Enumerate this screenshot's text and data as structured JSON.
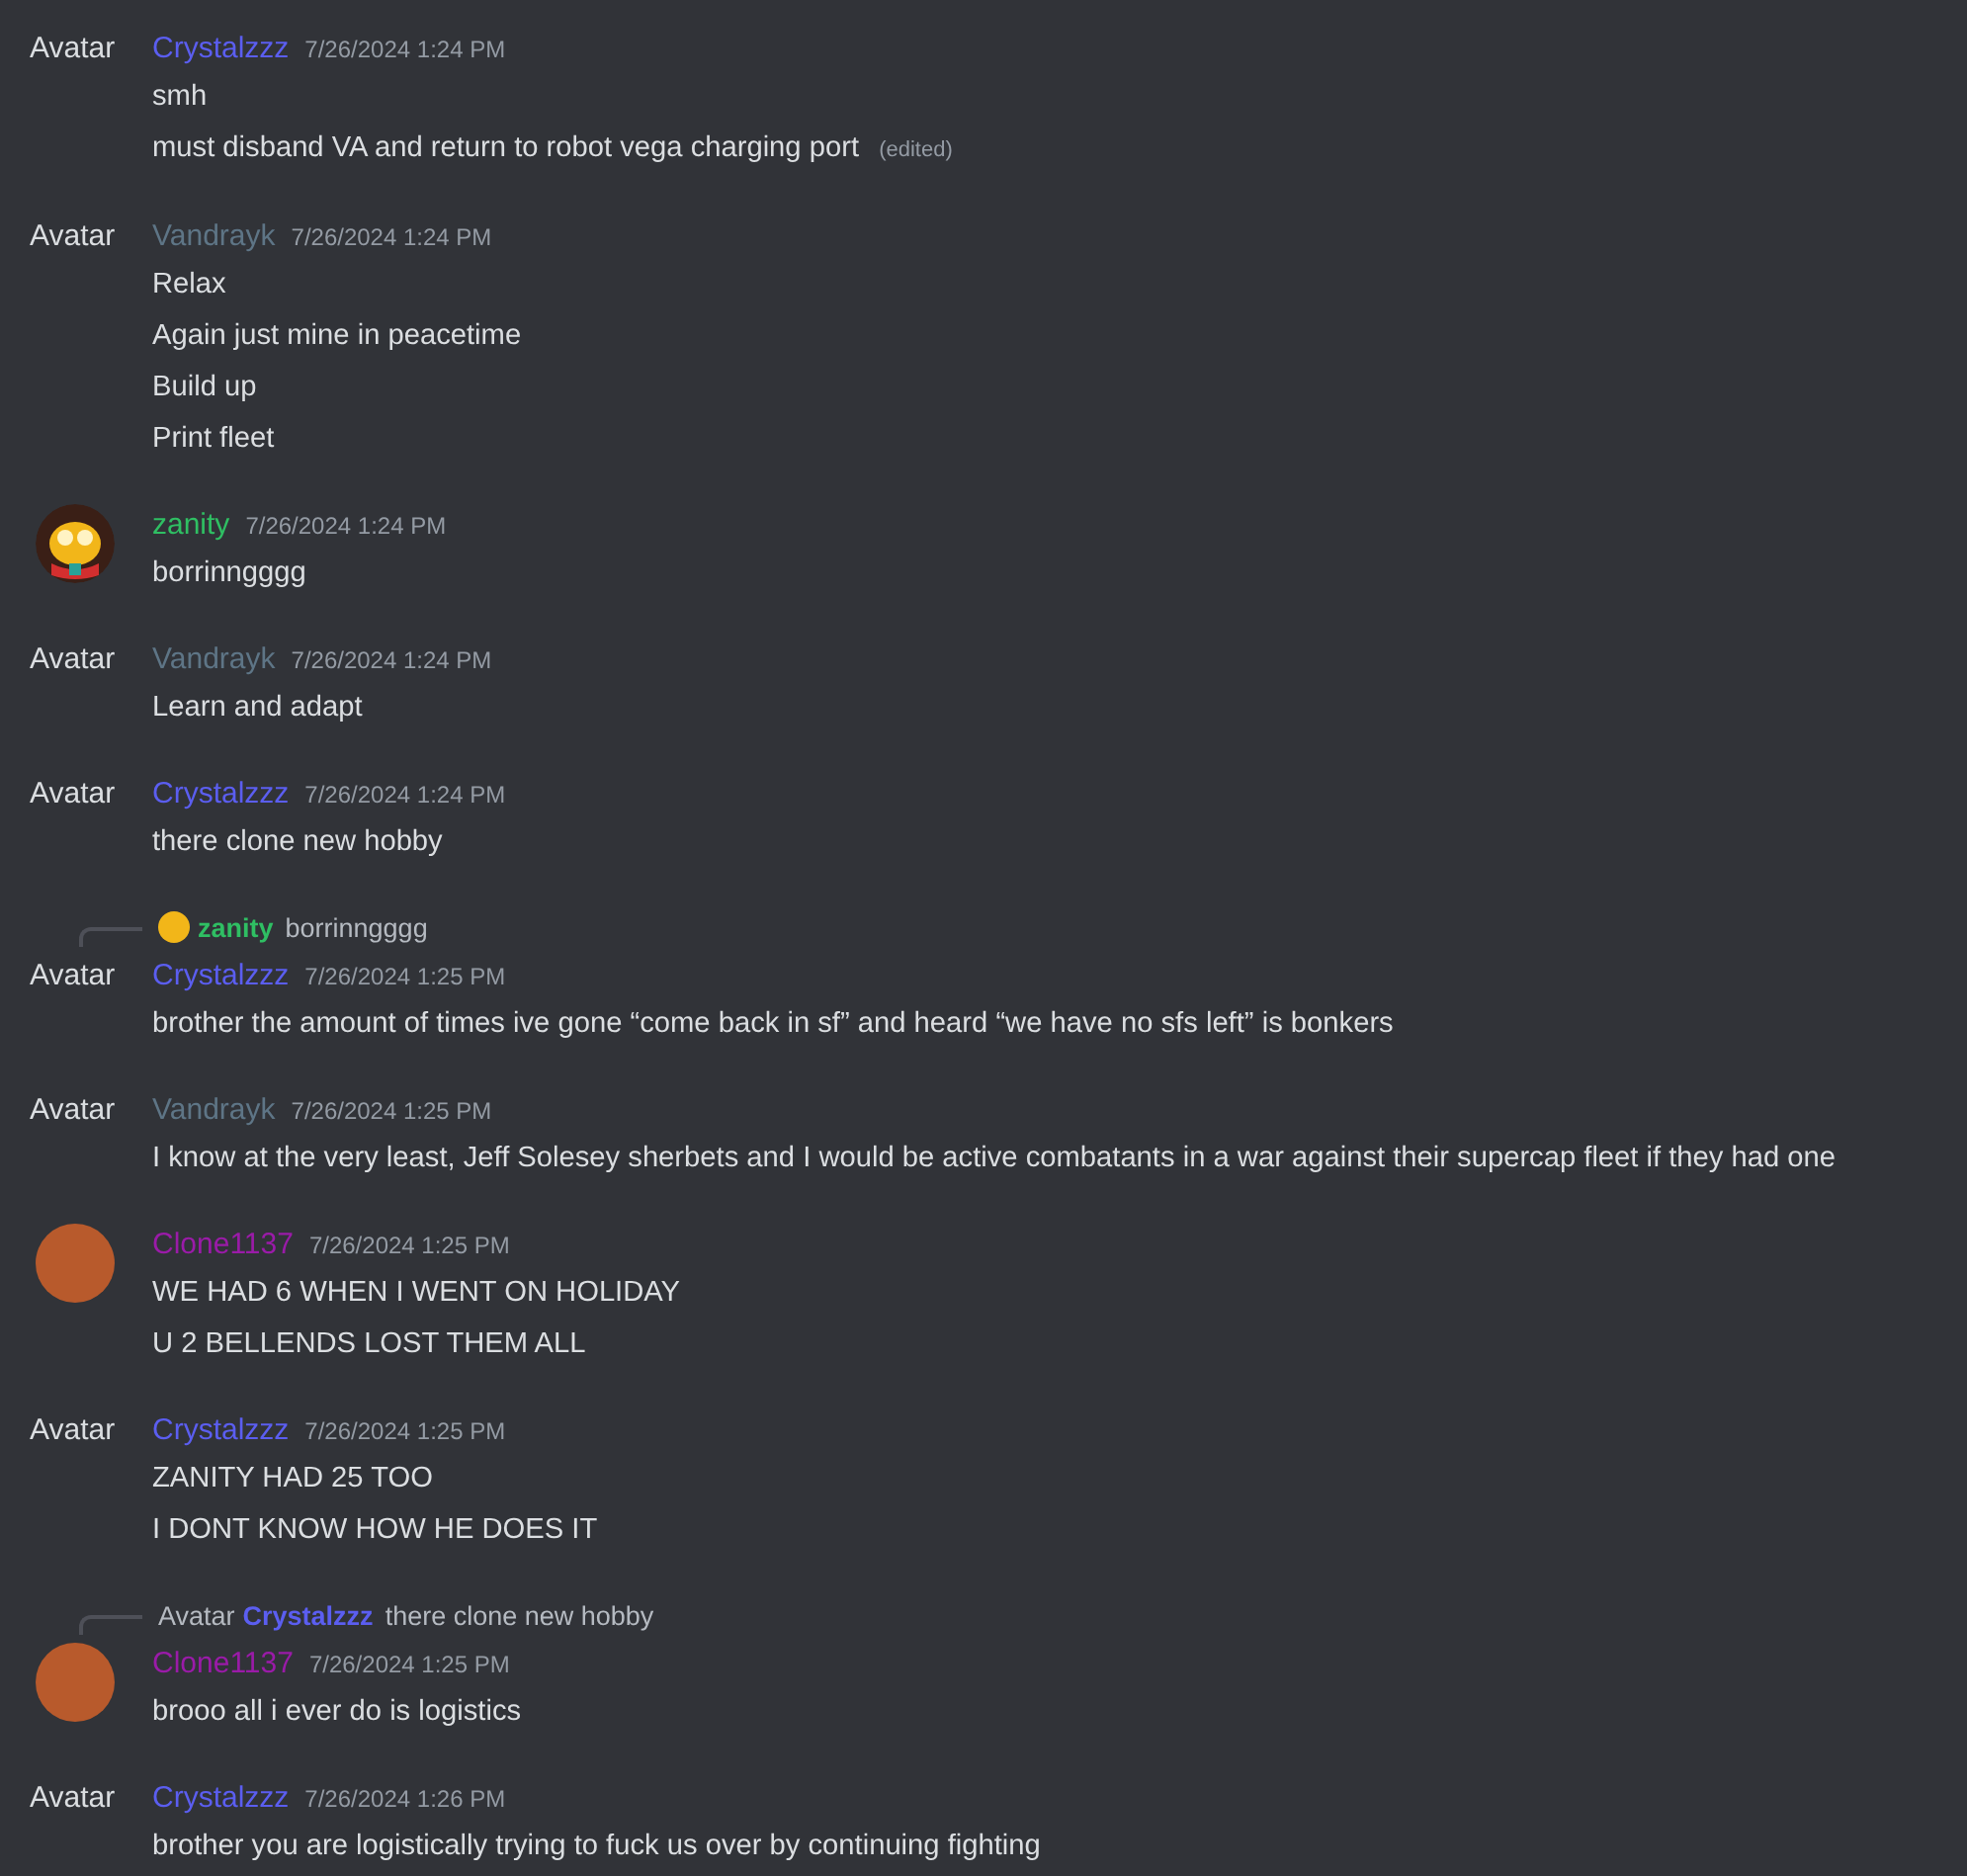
{
  "messages": [
    {
      "avatar": {
        "kind": "alt",
        "alt": "Avatar"
      },
      "author": "Crystalzzz",
      "color": "#5b5ef0",
      "timestamp": "7/26/2024 1:24 PM",
      "lines": [
        {
          "text": "smh"
        },
        {
          "text": "must disband VA and return to robot vega charging port",
          "edited": "(edited)"
        }
      ]
    },
    {
      "avatar": {
        "kind": "alt",
        "alt": "Avatar"
      },
      "author": "Vandrayk",
      "color": "#5e7586",
      "timestamp": "7/26/2024 1:24 PM",
      "lines": [
        {
          "text": "Relax"
        },
        {
          "text": "Again just mine in peacetime"
        },
        {
          "text": "Build up"
        },
        {
          "text": "Print fleet"
        }
      ]
    },
    {
      "avatar": {
        "kind": "cartoon"
      },
      "author": "zanity",
      "color": "#2fbf63",
      "timestamp": "7/26/2024 1:24 PM",
      "lines": [
        {
          "text": "borrinngggg"
        }
      ]
    },
    {
      "avatar": {
        "kind": "alt",
        "alt": "Avatar"
      },
      "author": "Vandrayk",
      "color": "#5e7586",
      "timestamp": "7/26/2024 1:24 PM",
      "lines": [
        {
          "text": "Learn and adapt"
        }
      ]
    },
    {
      "avatar": {
        "kind": "alt",
        "alt": "Avatar"
      },
      "author": "Crystalzzz",
      "color": "#5b5ef0",
      "timestamp": "7/26/2024 1:24 PM",
      "lines": [
        {
          "text": "there clone new hobby"
        }
      ]
    },
    {
      "reply": {
        "avatar": {
          "kind": "cartoon"
        },
        "author": "zanity",
        "color": "#2fbf63",
        "text": "borrinngggg"
      },
      "avatar": {
        "kind": "alt",
        "alt": "Avatar"
      },
      "author": "Crystalzzz",
      "color": "#5b5ef0",
      "timestamp": "7/26/2024 1:25 PM",
      "lines": [
        {
          "text": "brother the amount of times ive gone “come back in sf” and heard “we have no sfs left” is bonkers"
        }
      ]
    },
    {
      "avatar": {
        "kind": "alt",
        "alt": "Avatar"
      },
      "author": "Vandrayk",
      "color": "#5e7586",
      "timestamp": "7/26/2024 1:25 PM",
      "lines": [
        {
          "text": "I know at the very least, Jeff Solesey sherbets and I would be active combatants in a war against their supercap fleet if they had one"
        }
      ]
    },
    {
      "avatar": {
        "kind": "photo"
      },
      "author": "Clone1137",
      "color": "#9a1ba8",
      "timestamp": "7/26/2024 1:25 PM",
      "lines": [
        {
          "text": "WE HAD 6 WHEN I WENT ON HOLIDAY"
        },
        {
          "text": "U 2 BELLENDS LOST THEM ALL"
        }
      ]
    },
    {
      "avatar": {
        "kind": "alt",
        "alt": "Avatar"
      },
      "author": "Crystalzzz",
      "color": "#5b5ef0",
      "timestamp": "7/26/2024 1:25 PM",
      "lines": [
        {
          "text": "ZANITY HAD 25 TOO"
        },
        {
          "text": "I DONT KNOW HOW HE DOES IT"
        }
      ]
    },
    {
      "reply": {
        "avatar": {
          "kind": "alt",
          "alt": "Avatar"
        },
        "author": "Crystalzzz",
        "color": "#5b5ef0",
        "text": "there clone new hobby"
      },
      "avatar": {
        "kind": "photo"
      },
      "author": "Clone1137",
      "color": "#9a1ba8",
      "timestamp": "7/26/2024 1:25 PM",
      "lines": [
        {
          "text": "brooo all i ever do is logistics"
        }
      ]
    },
    {
      "avatar": {
        "kind": "alt",
        "alt": "Avatar"
      },
      "author": "Crystalzzz",
      "color": "#5b5ef0",
      "timestamp": "7/26/2024 1:26 PM",
      "lines": [
        {
          "text": "brother you are logistically trying to fuck us over by continuing fighting"
        }
      ]
    }
  ]
}
